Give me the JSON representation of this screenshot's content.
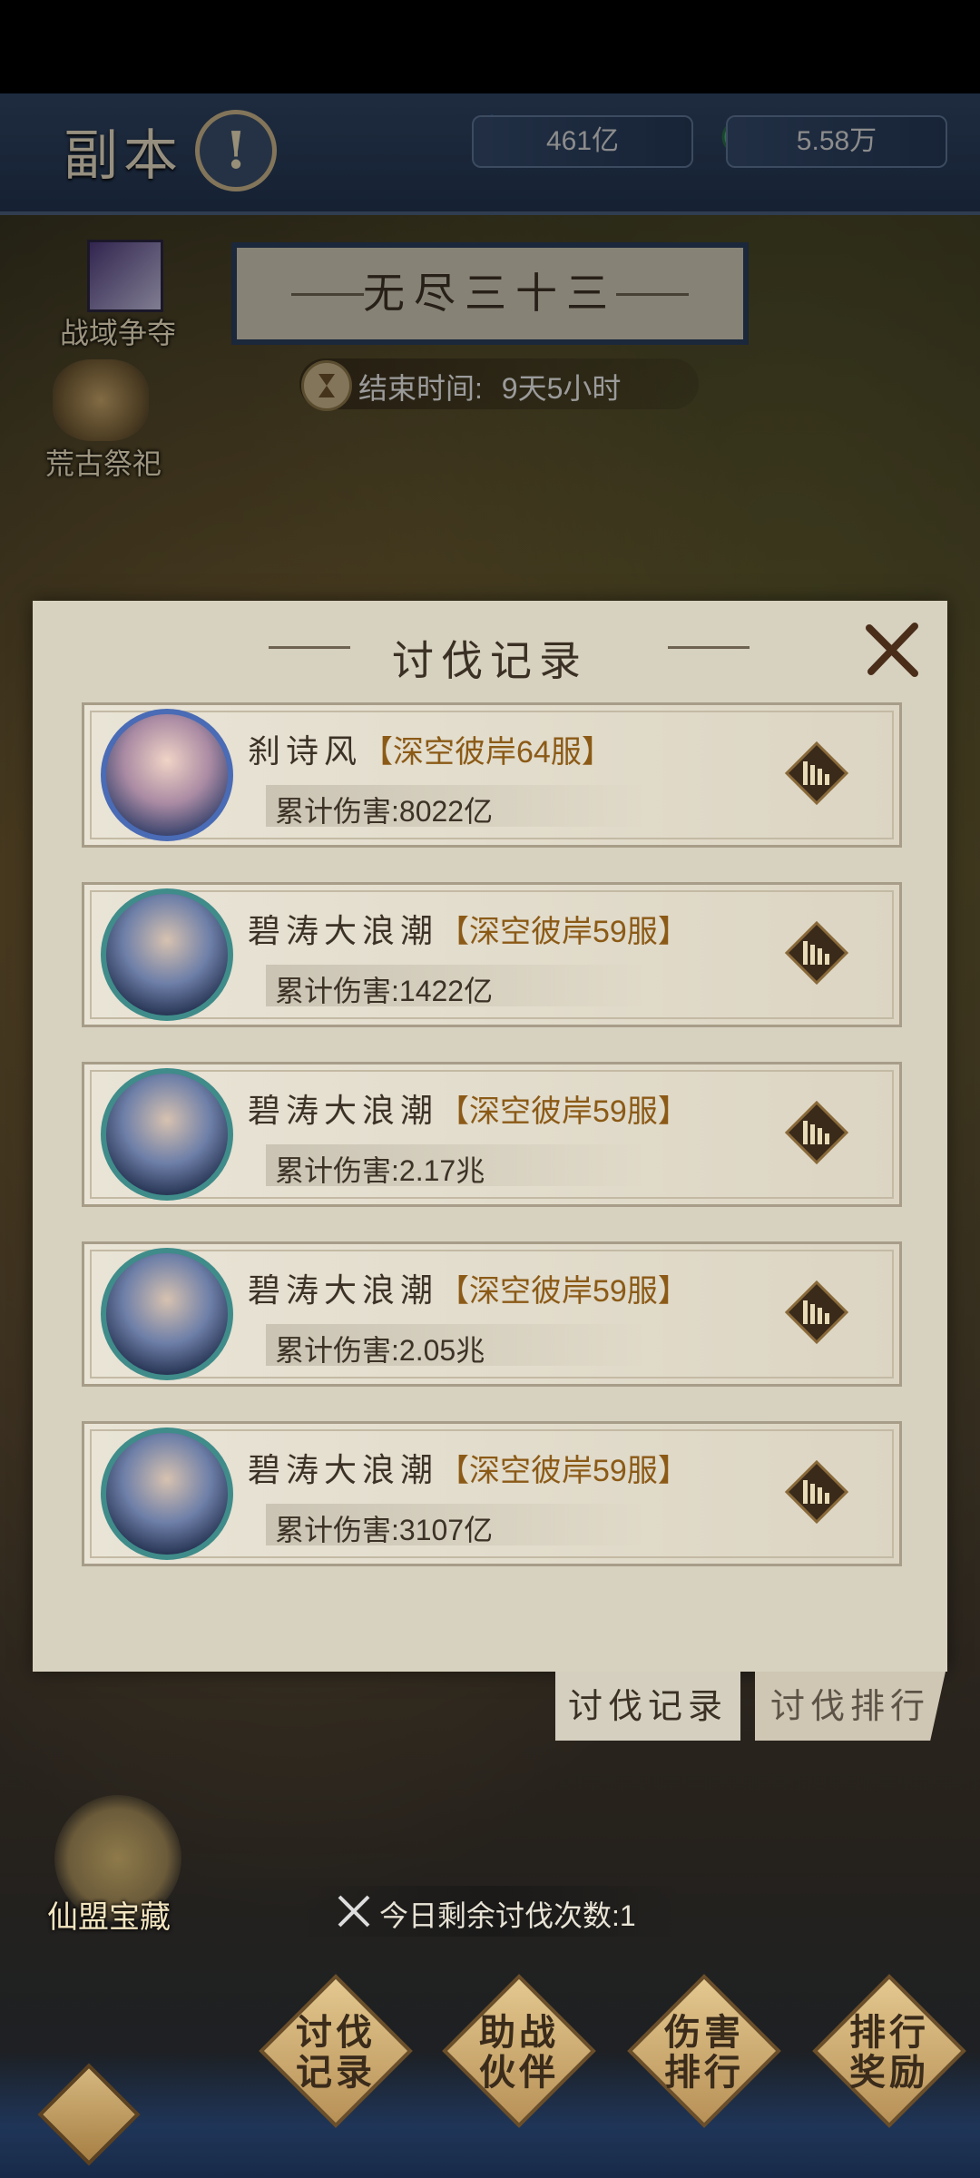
{
  "header": {
    "title": "副本",
    "info_label": "!",
    "crystals": "461亿",
    "jade": "5.58万"
  },
  "side": {
    "battle_label": "战域争夺",
    "sacrifice_label": "荒古祭祀"
  },
  "event": {
    "title": "无尽三十三",
    "end_time_label": "结束时间:",
    "end_time_value": "9天5小时"
  },
  "modal": {
    "title": "讨伐记录",
    "rows": [
      {
        "name": "刹诗风",
        "server": "【深空彼岸64服】",
        "damage_label": "累计伤害:",
        "damage": "8022亿",
        "avatar": "female"
      },
      {
        "name": "碧涛大浪潮",
        "server": "【深空彼岸59服】",
        "damage_label": "累计伤害:",
        "damage": "1422亿",
        "avatar": "male"
      },
      {
        "name": "碧涛大浪潮",
        "server": "【深空彼岸59服】",
        "damage_label": "累计伤害:",
        "damage": "2.17兆",
        "avatar": "male"
      },
      {
        "name": "碧涛大浪潮",
        "server": "【深空彼岸59服】",
        "damage_label": "累计伤害:",
        "damage": "2.05兆",
        "avatar": "male"
      },
      {
        "name": "碧涛大浪潮",
        "server": "【深空彼岸59服】",
        "damage_label": "累计伤害:",
        "damage": "3107亿",
        "avatar": "male"
      }
    ]
  },
  "tabs": {
    "records": "讨伐记录",
    "ranking": "讨伐排行"
  },
  "treasure": {
    "label": "仙盟宝藏"
  },
  "attempts": "今日剩余讨伐次数:1",
  "bottom": {
    "btn1_line1": "讨伐",
    "btn1_line2": "记录",
    "btn2_line1": "助战",
    "btn2_line2": "伙伴",
    "btn3_line1": "伤害",
    "btn3_line2": "排行",
    "btn4_line1": "排行",
    "btn4_line2": "奖励"
  }
}
